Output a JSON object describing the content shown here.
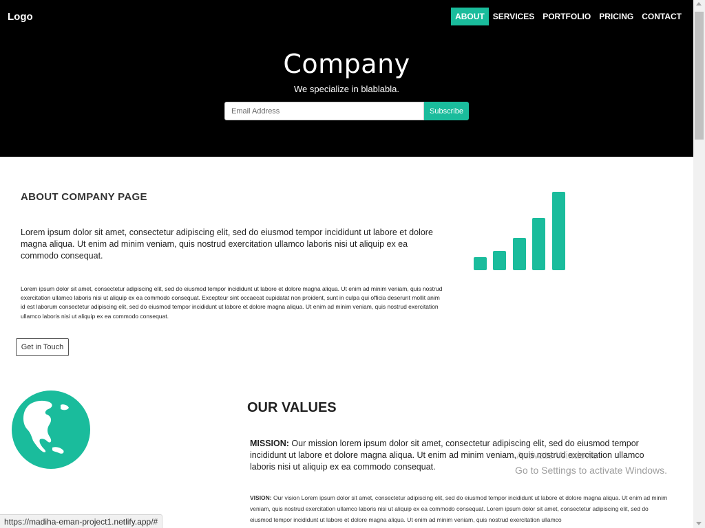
{
  "header": {
    "logo": "Logo",
    "nav": [
      {
        "label": "ABOUT",
        "active": true
      },
      {
        "label": "SERVICES",
        "active": false
      },
      {
        "label": "PORTFOLIO",
        "active": false
      },
      {
        "label": "PRICING",
        "active": false
      },
      {
        "label": "CONTACT",
        "active": false
      }
    ]
  },
  "hero": {
    "title": "Company",
    "subtitle": "We specialize in blablabla.",
    "email_placeholder": "Email Address",
    "subscribe_label": "Subscribe"
  },
  "about": {
    "title": "ABOUT COMPANY PAGE",
    "paragraph_large": "Lorem ipsum dolor sit amet, consectetur adipiscing elit, sed do eiusmod tempor incididunt ut labore et dolore magna aliqua. Ut enim ad minim veniam, quis nostrud exercitation ullamco laboris nisi ut aliquip ex ea commodo consequat.",
    "paragraph_small": "Lorem ipsum dolor sit amet, consectetur adipiscing elit, sed do eiusmod tempor incididunt ut labore et dolore magna aliqua. Ut enim ad minim veniam, quis nostrud exercitation ullamco laboris nisi ut aliquip ex ea commodo consequat. Excepteur sint occaecat cupidatat non proident, sunt in culpa qui officia deserunt mollit anim id est laborum consectetur adipiscing elit, sed do eiusmod tempor incididunt ut labore et dolore magna aliqua. Ut enim ad minim veniam, quis nostrud exercitation ullamco laboris nisi ut aliquip ex ea commodo consequat.",
    "button_label": "Get in Touch",
    "icon": "signal-bars-icon"
  },
  "values": {
    "title": "OUR VALUES",
    "icon": "globe-icon",
    "mission_label": "MISSION:",
    "mission_text": " Our mission lorem ipsum dolor sit amet, consectetur adipiscing elit, sed do eiusmod tempor incididunt ut labore et dolore magna aliqua. Ut enim ad minim veniam, quis nostrud exercitation ullamco laboris nisi ut aliquip ex ea commodo consequat.",
    "vision_label": "VISION:",
    "vision_text": " Our vision Lorem ipsum dolor sit amet, consectetur adipiscing elit, sed do eiusmod tempor incididunt ut labore et dolore magna aliqua. Ut enim ad minim veniam, quis nostrud exercitation ullamco laboris nisi ut aliquip ex ea commodo consequat. Lorem ipsum dolor sit amet, consectetur adipiscing elit, sed do eiusmod tempor incididunt ut labore et dolore magna aliqua. Ut enim ad minim veniam, quis nostrud exercitation ullamco"
  },
  "watermark": {
    "line1": "Activate Windows",
    "line2": "Go to Settings to activate Windows."
  },
  "status_url": "https://madiha-eman-project1.netlify.app/#",
  "colors": {
    "accent": "#1abc9c",
    "hero_bg": "#000000"
  }
}
